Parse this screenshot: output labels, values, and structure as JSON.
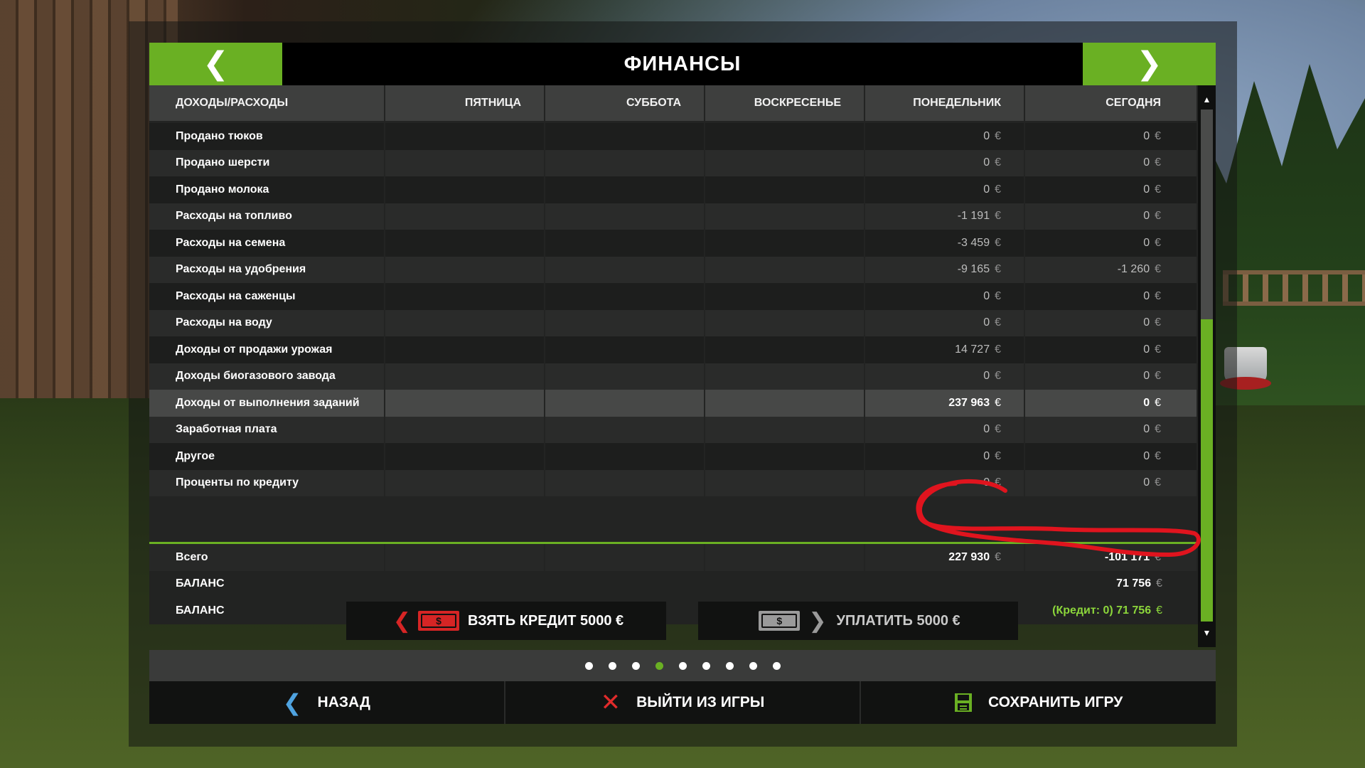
{
  "header": {
    "title": "ФИНАНСЫ"
  },
  "table": {
    "columns": [
      "ДОХОДЫ/РАСХОДЫ",
      "ПЯТНИЦА",
      "СУББОТА",
      "ВОСКРЕСЕНЬЕ",
      "ПОНЕДЕЛЬНИК",
      "СЕГОДНЯ"
    ],
    "currency": "€",
    "rows": [
      {
        "label": "Продано тюков",
        "monday": "0",
        "today": "0"
      },
      {
        "label": "Продано шерсти",
        "monday": "0",
        "today": "0"
      },
      {
        "label": "Продано молока",
        "monday": "0",
        "today": "0"
      },
      {
        "label": "Расходы на топливо",
        "monday": "-1 191",
        "today": "0"
      },
      {
        "label": "Расходы на семена",
        "monday": "-3 459",
        "today": "0"
      },
      {
        "label": "Расходы на удобрения",
        "monday": "-9 165",
        "today": "-1 260"
      },
      {
        "label": "Расходы на саженцы",
        "monday": "0",
        "today": "0"
      },
      {
        "label": "Расходы на воду",
        "monday": "0",
        "today": "0"
      },
      {
        "label": "Доходы от продажи урожая",
        "monday": "14 727",
        "today": "0"
      },
      {
        "label": "Доходы биогазового завода",
        "monday": "0",
        "today": "0"
      },
      {
        "label": "Доходы от выполнения заданий",
        "monday": "237 963",
        "today": "0"
      },
      {
        "label": "Заработная плата",
        "monday": "0",
        "today": "0"
      },
      {
        "label": "Другое",
        "monday": "0",
        "today": "0"
      },
      {
        "label": "Проценты по кредиту",
        "monday": "0",
        "today": "0"
      }
    ],
    "total": {
      "label": "Всего",
      "monday": "227 930",
      "today": "-101 171"
    },
    "balance": {
      "label": "БАЛАНС",
      "value": "71 756"
    },
    "balance_credit": {
      "label": "БАЛАНС",
      "value": "(Кредит: 0) 71 756"
    }
  },
  "actions": {
    "take_credit": "ВЗЯТЬ КРЕДИТ 5000 €",
    "pay_credit": "УПЛАТИТЬ 5000 €"
  },
  "pager": {
    "count": 9,
    "active": 4
  },
  "footer": {
    "back": "НАЗАД",
    "quit": "ВЫЙТИ ИЗ ИГРЫ",
    "save": "СОХРАНИТЬ ИГРУ"
  },
  "scrollbar": {
    "position_fraction": 0.41,
    "visible_fraction": 0.59
  },
  "colors": {
    "accent": "#6ab023",
    "credit": "#8cd63b",
    "annotation": "#e0141e"
  }
}
